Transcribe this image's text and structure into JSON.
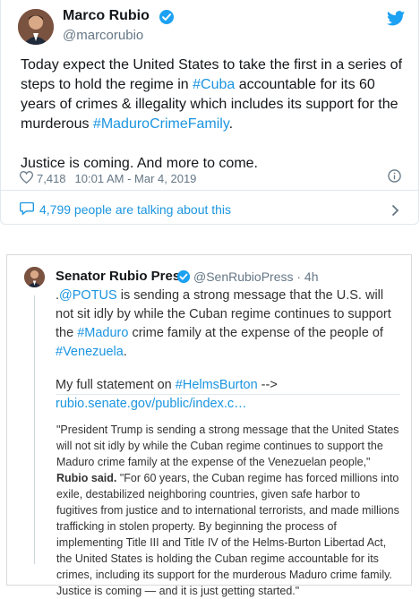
{
  "tweet": {
    "author_name": "Marco Rubio",
    "handle": "@marcorubio",
    "text_part1": "Today expect the United States to take the first in a series of steps to hold the regime in ",
    "hashtag_cuba": "#Cuba",
    "text_part2": " accountable for its 60 years of crimes & illegality which includes its support for the murderous ",
    "hashtag_maduro": "#MaduroCrimeFamily",
    "text_part3": ".",
    "text_second_paragraph": "Justice is coming. And more to come.",
    "likes": "7,418",
    "timestamp": "10:01 AM - Mar 4, 2019",
    "talking": "4,799 people are talking about this"
  },
  "embed": {
    "author_name": "Senator Rubio Press",
    "handle_time": "@SenRubioPress · 4h",
    "line_dot": ".",
    "mention_potus": "@POTUS",
    "line_part1": " is sending a strong message that the U.S. will not sit idly by while the Cuban regime continues to support the ",
    "hashtag_maduro": "#Maduro",
    "line_part2": " crime family at the expense of the people of ",
    "hashtag_venezuela": "#Venezuela",
    "line_part3": ".",
    "statement_prefix": "My full statement on ",
    "hashtag_helms": "#HelmsBurton",
    "statement_arrow": " --> ",
    "statement_link": "rubio.senate.gov/public/index.c…",
    "quote_part1": "\"President Trump is sending a strong message that the United States will not sit idly by while the Cuban regime continues to support the Maduro crime family at the expense of the Venezuelan people,\" ",
    "quote_bold": "Rubio said.",
    "quote_part2": " \"For 60 years, the Cuban regime has forced millions into exile, destabilized neighboring countries, given safe harbor to fugitives from justice and to international terrorists, and made millions trafficking in stolen property. By beginning the process of implementing Title III and Title IV of the Helms-Burton Libertad Act, the United States is holding the Cuban regime accountable for its crimes, including its support for the murderous Maduro crime family. Justice is coming — and it is just getting started.\""
  },
  "colors": {
    "link": "#1b95e0",
    "muted": "#657786",
    "text": "#14171a"
  },
  "icons": {
    "verified": "verified-badge-icon",
    "bird": "twitter-bird-icon",
    "heart": "heart-icon",
    "info": "info-icon",
    "reply": "speech-bubble-icon",
    "chevron": "chevron-right-icon"
  }
}
